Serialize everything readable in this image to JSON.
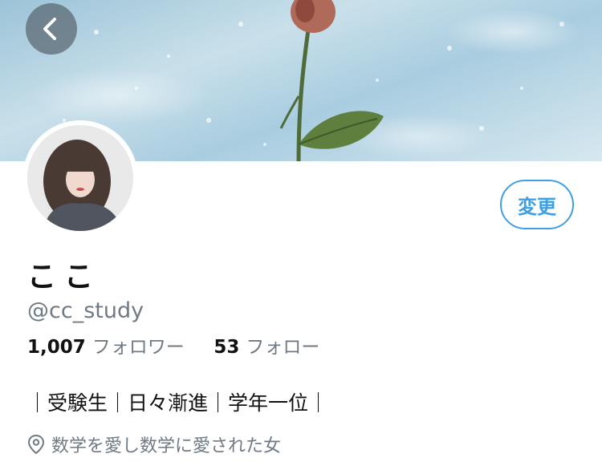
{
  "profile": {
    "display_name": "ここ",
    "handle": "@cc_study",
    "followers_count": "1,007",
    "followers_label": "フォロワー",
    "following_count": "53",
    "following_label": "フォロー",
    "bio": "｜受験生｜日々漸進｜学年一位｜",
    "location": "数学を愛し数学に愛された女"
  },
  "actions": {
    "edit_label": "変更"
  },
  "icons": {
    "back": "chevron-left-icon",
    "location": "map-pin-icon"
  },
  "colors": {
    "accent": "#3f9fe6",
    "secondary_text": "#6f7a84",
    "primary_text": "#111111"
  }
}
